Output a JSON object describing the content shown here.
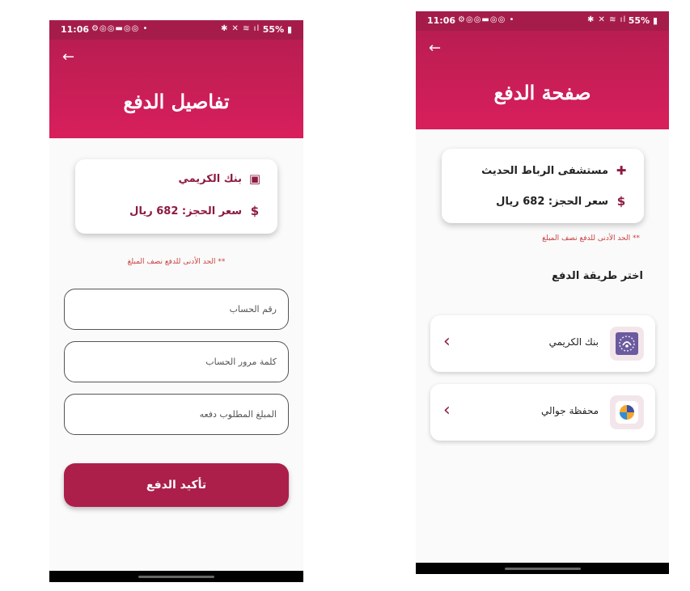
{
  "status_bar": {
    "time": "11:06",
    "battery": "55%"
  },
  "screen1": {
    "title": "تفاصيل الدفع",
    "bank_name": "بنك الكريمي",
    "price_label": "سعر الحجز: 682 ريال",
    "min_note": "** الحد الأدنى للدفع نصف المبلغ",
    "fields": {
      "account_placeholder": "رقم الحساب",
      "password_placeholder": "كلمة مرور الحساب",
      "amount_placeholder": "المبلغ المطلوب دفعه"
    },
    "confirm_label": "تأكيد الدفع"
  },
  "screen2": {
    "title": "صفحة الدفع",
    "hospital_name": "مستشفى الرباط الحديث",
    "price_label": "سعر الحجز: 682 ريال",
    "min_note": "** الحد الأدنى للدفع نصف المبلغ",
    "choose_label": "اختر طريقة الدفع",
    "options": [
      {
        "label": "بنك الكريمي",
        "icon": "kuraimi-bank-logo"
      },
      {
        "label": "محفظة جوالي",
        "icon": "jawali-wallet-logo"
      }
    ]
  },
  "colors": {
    "header": "#d81f5c",
    "accent": "#8d1a40",
    "button": "#ac1f4a",
    "note": "#c93f3f"
  }
}
